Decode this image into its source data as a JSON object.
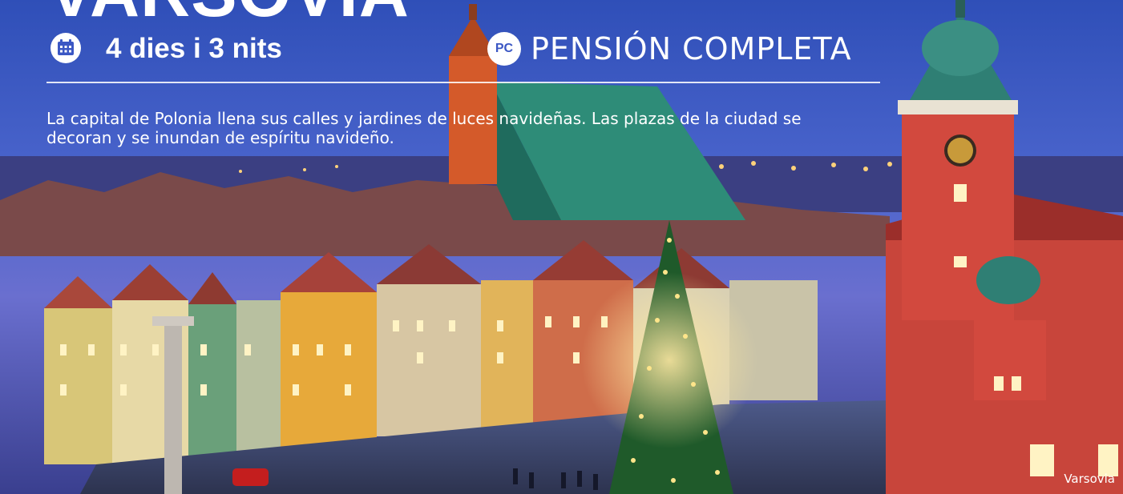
{
  "banner": {
    "title": "VARSOVIA",
    "duration": "4 dies i 3 nits",
    "duration_icon": "calendar-icon",
    "board_badge": "PC",
    "board": "PENSIÓN COMPLETA",
    "description": "La capital de Polonia llena sus calles y jardines de luces navideñas. Las plazas de la ciudad se decoran y se inundan de espíritu navideño.",
    "photo_caption": "Varsovia"
  }
}
